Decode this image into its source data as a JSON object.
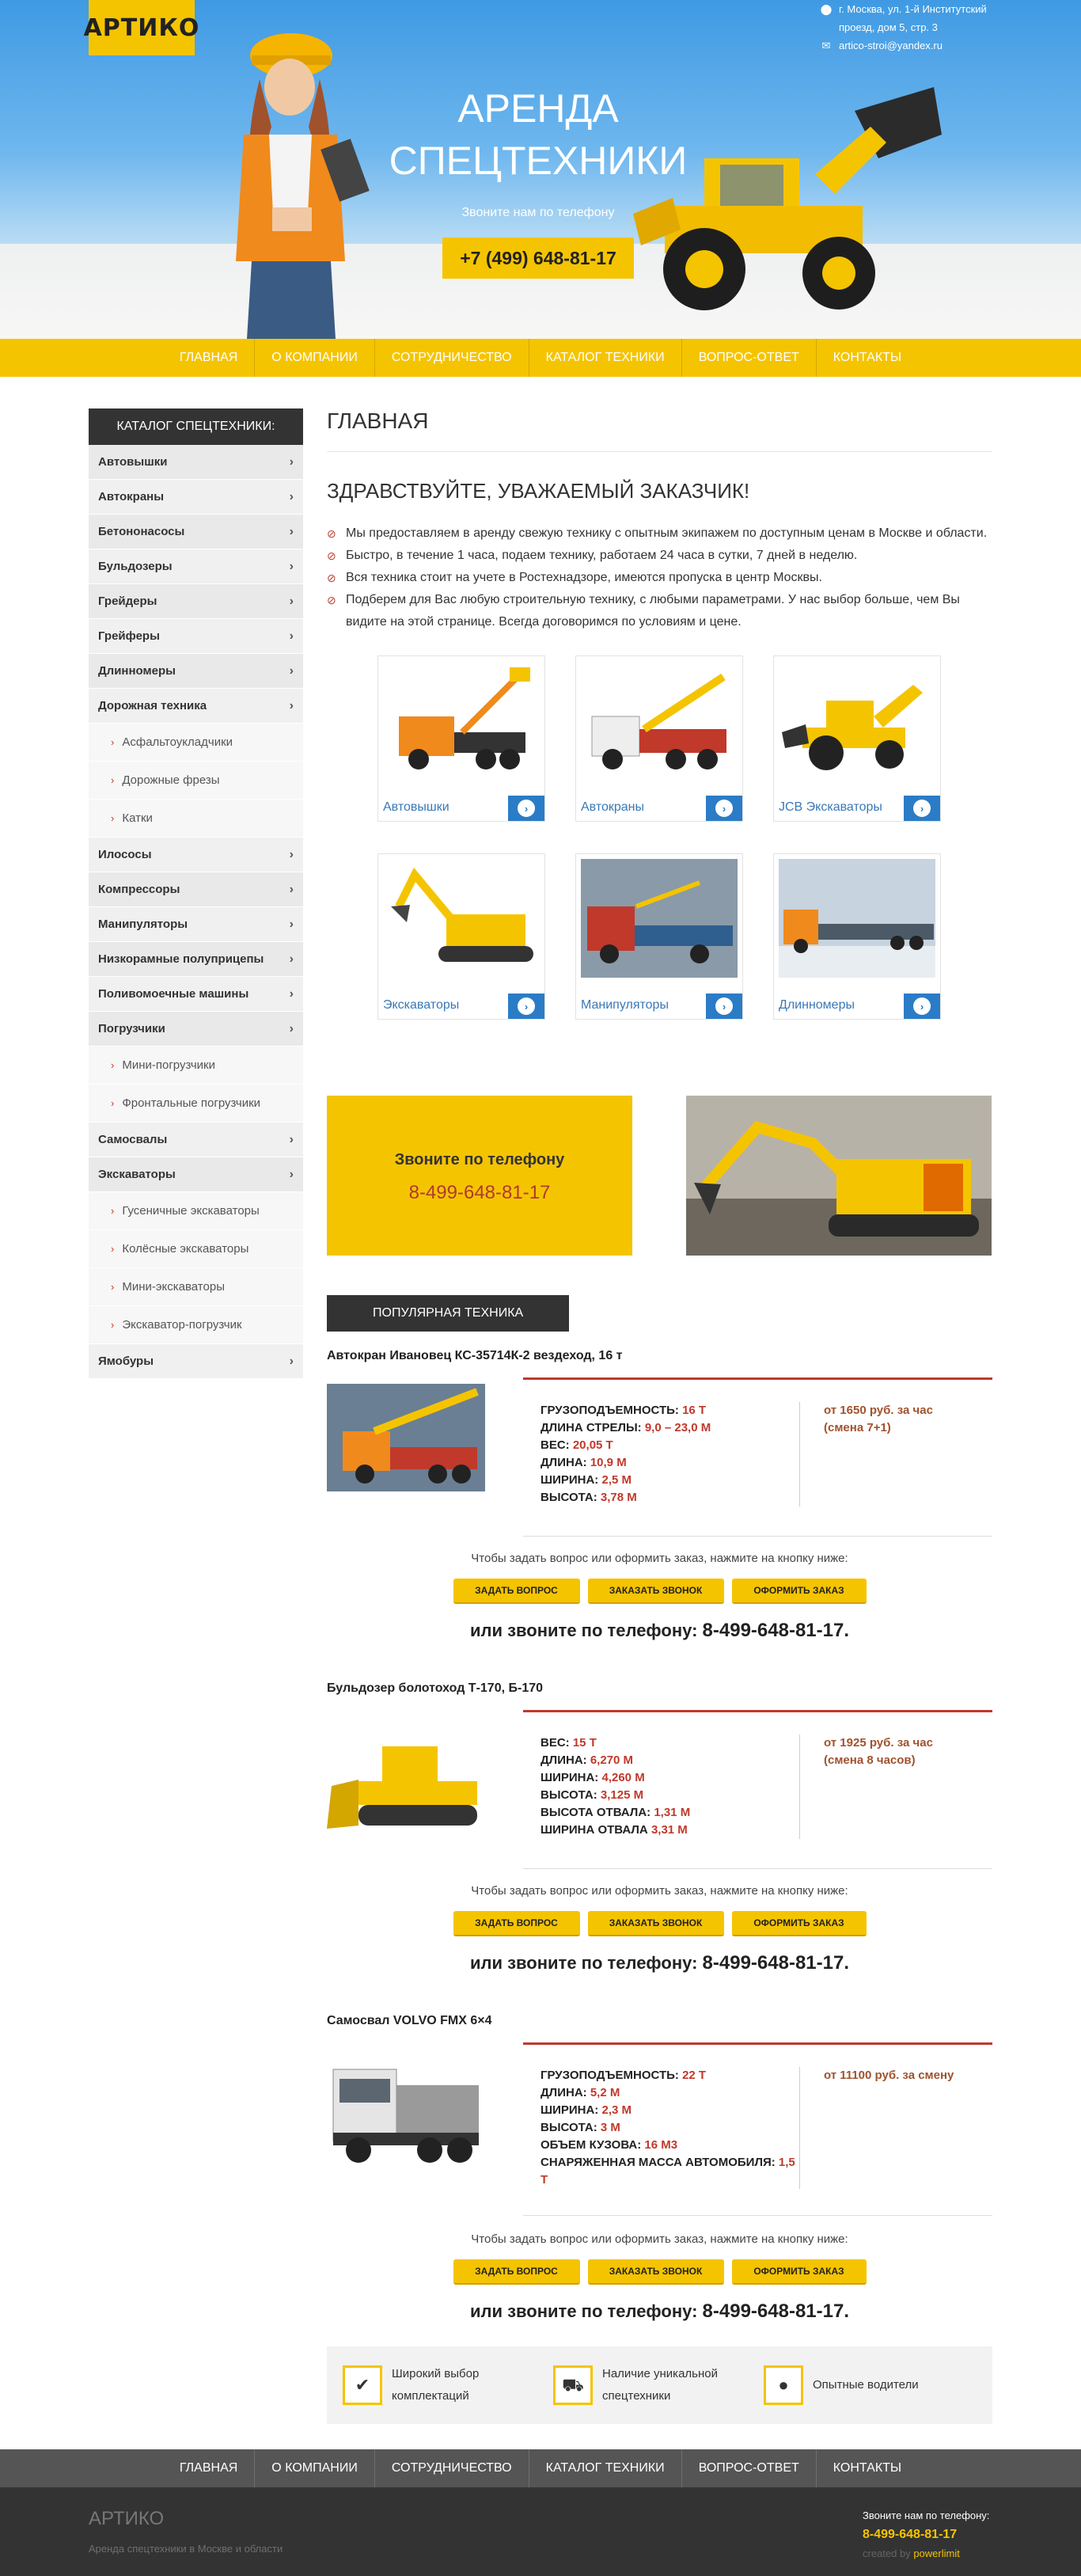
{
  "header": {
    "logo_text": "АРТИКО",
    "address_line1": "г. Москва, ул. 1-й Институтский",
    "address_line2": "проезд, дом 5, стр. 3",
    "email": "artico-stroi@yandex.ru",
    "title_line1": "АРЕНДА",
    "title_line2": "СПЕЦТЕХНИКИ",
    "subtitle": "Звоните нам по телефону",
    "phone": "+7 (499) 648-81-17"
  },
  "nav": [
    "ГЛАВНАЯ",
    "О КОМПАНИИ",
    "СОТРУДНИЧЕСТВО",
    "КАТАЛОГ ТЕХНИКИ",
    "ВОПРОС-ОТВЕТ",
    "КОНТАКТЫ"
  ],
  "sidebar": {
    "title": "КАТАЛОГ СПЕЦТЕХНИКИ:",
    "items": [
      {
        "label": "Автовышки"
      },
      {
        "label": "Автокраны"
      },
      {
        "label": "Бетононасосы"
      },
      {
        "label": "Бульдозеры"
      },
      {
        "label": "Грейдеры"
      },
      {
        "label": "Грейферы"
      },
      {
        "label": "Длинномеры"
      },
      {
        "label": "Дорожная техника",
        "sub": [
          "Асфальтоукладчики",
          "Дорожные фрезы",
          "Катки"
        ]
      },
      {
        "label": "Илососы"
      },
      {
        "label": "Компрессоры"
      },
      {
        "label": "Манипуляторы"
      },
      {
        "label": "Низкорамные полуприцепы"
      },
      {
        "label": "Поливомоечные машины"
      },
      {
        "label": "Погрузчики",
        "sub": [
          "Мини-погрузчики",
          "Фронтальные погрузчики"
        ]
      },
      {
        "label": "Самосвалы"
      },
      {
        "label": "Экскаваторы",
        "sub": [
          "Гусеничные экскаваторы",
          "Колёсные экскаваторы",
          "Мини-экскаваторы",
          "Экскаватор-погрузчик"
        ]
      },
      {
        "label": "Ямобуры"
      }
    ]
  },
  "content": {
    "page_title": "ГЛАВНАЯ",
    "greeting": "ЗДРАВСТВУЙТЕ, УВАЖАЕМЫЙ ЗАКАЗЧИК!",
    "features": [
      "Мы предоставляем в аренду свежую технику с опытным экипажем по доступным ценам в Москве и области.",
      "Быстро, в течение 1 часа, подаем технику, работаем 24 часа в сутки, 7 дней в неделю.",
      "Вся техника стоит на учете в Ростехнадзоре, имеются пропуска в центр Москвы.",
      "Подберем для Вас любую строительную технику, с любыми параметрами. У нас выбор больше, чем Вы видите на этой странице. Всегда договоримся по условиям и цене."
    ],
    "categories": [
      "Автовышки",
      "Автокраны",
      "JCB Экскаваторы",
      "Экскаваторы",
      "Манипуляторы",
      "Длинномеры"
    ],
    "promo_title": "Звоните по телефону",
    "promo_phone": "8-499-648-81-17",
    "popular_title": "ПОПУЛЯРНАЯ ТЕХНИКА",
    "ask_text": "Чтобы задать вопрос или оформить заказ, нажмите на кнопку ниже:",
    "btn_ask": "ЗАДАТЬ ВОПРОС",
    "btn_call": "ЗАКАЗАТЬ ЗВОНОК",
    "btn_order": "ОФОРМИТЬ ЗАКАЗ",
    "call_text": "или звоните по телефону:",
    "call_phone": "8-499-648-81-17.",
    "products": [
      {
        "name": "Автокран Ивановец КС-35714К-2 вездеход, 16 т",
        "specs": [
          [
            "ГРУЗОПОДЪЕМНОСТЬ:",
            "16 Т"
          ],
          [
            "ДЛИНА СТРЕЛЫ:",
            "9,0 – 23,0 М"
          ],
          [
            "ВЕС:",
            "20,05 Т"
          ],
          [
            "ДЛИНА:",
            "10,9 М"
          ],
          [
            "ШИРИНА:",
            "2,5 М"
          ],
          [
            "ВЫСОТА:",
            "3,78 М"
          ]
        ],
        "price": "от 1650 руб. за час (смена 7+1)"
      },
      {
        "name": "Бульдозер болотоход Т-170, Б-170",
        "specs": [
          [
            "ВЕС:",
            "15 Т"
          ],
          [
            "ДЛИНА:",
            "6,270 М"
          ],
          [
            "ШИРИНА:",
            "4,260 М"
          ],
          [
            "ВЫСОТА:",
            "3,125 М"
          ],
          [
            "ВЫСОТА ОТВАЛА:",
            "1,31 М"
          ],
          [
            "ШИРИНА ОТВАЛА",
            "3,31 М"
          ]
        ],
        "price": "от 1925 руб. за час (смена 8 часов)"
      },
      {
        "name": "Самосвал VOLVO FMX 6×4",
        "specs": [
          [
            "ГРУЗОПОДЪЕМНОСТЬ:",
            "22 Т"
          ],
          [
            "ДЛИНА:",
            "5,2 М"
          ],
          [
            "ШИРИНА:",
            "2,3 М"
          ],
          [
            "ВЫСОТА:",
            "3 М"
          ],
          [
            "ОБЪЕМ КУЗОВА:",
            "16 М3"
          ],
          [
            "СНАРЯЖЕННАЯ МАССА АВТОМОБИЛЯ:",
            "1,5 Т"
          ]
        ],
        "price": "от 11100 руб. за смену"
      }
    ],
    "advantages": [
      "Широкий выбор комплектаций",
      "Наличие уникальной спецтехники",
      "Опытные водители"
    ]
  },
  "footer": {
    "brand": "АРТИКО",
    "tagline": "Аренда спецтехники в Москве и области",
    "call_label": "Звоните нам по телефону:",
    "phone": "8-499-648-81-17",
    "credit_prefix": "created by",
    "credit_name": "powerlimit"
  },
  "colors": {
    "accent": "#f5c400",
    "dark": "#333333",
    "red": "#c0392b",
    "link": "#3a78b8",
    "button_blue": "#2a7cc7"
  }
}
